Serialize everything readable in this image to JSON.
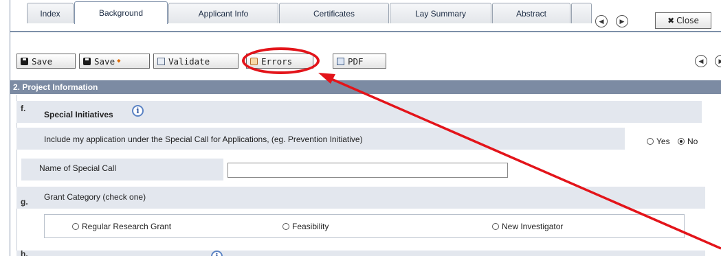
{
  "tabs": [
    {
      "label": "Index",
      "active": false
    },
    {
      "label": "Background",
      "active": true
    },
    {
      "label": "Applicant Info",
      "active": false
    },
    {
      "label": "Certificates",
      "active": false
    },
    {
      "label": "Lay Summary",
      "active": false
    },
    {
      "label": "Abstract",
      "active": false
    }
  ],
  "close_label": "Close",
  "toolbar": {
    "save_label": "Save",
    "save_plus_label": "Save",
    "validate_label": "Validate",
    "errors_label": "Errors",
    "pdf_label": "PDF"
  },
  "section": {
    "title": "2. Project Information"
  },
  "special_initiatives": {
    "letter": "f.",
    "title": "Special Initiatives",
    "question": "Include my application under the Special Call for Applications, (eg. Prevention Initiative)",
    "options": [
      {
        "label": "Yes",
        "checked": false
      },
      {
        "label": "No",
        "checked": true
      }
    ],
    "name_label": "Name of Special Call",
    "name_value": ""
  },
  "grant_category": {
    "letter": "g.",
    "title": "Grant Category (check one)",
    "options": [
      {
        "label": "Regular Research Grant",
        "checked": false
      },
      {
        "label": "Feasibility",
        "checked": false
      },
      {
        "label": "New Investigator",
        "checked": false
      }
    ]
  },
  "next_row": {
    "letter": "h."
  },
  "colors": {
    "annotation": "#e3141a",
    "section_header": "#7c8ba3",
    "row_bg": "#e3e7ee"
  },
  "icons": [
    "info-icon",
    "save-icon",
    "validate-icon",
    "errors-icon",
    "pdf-icon",
    "scroll-left-icon",
    "scroll-right-icon",
    "close-icon"
  ]
}
